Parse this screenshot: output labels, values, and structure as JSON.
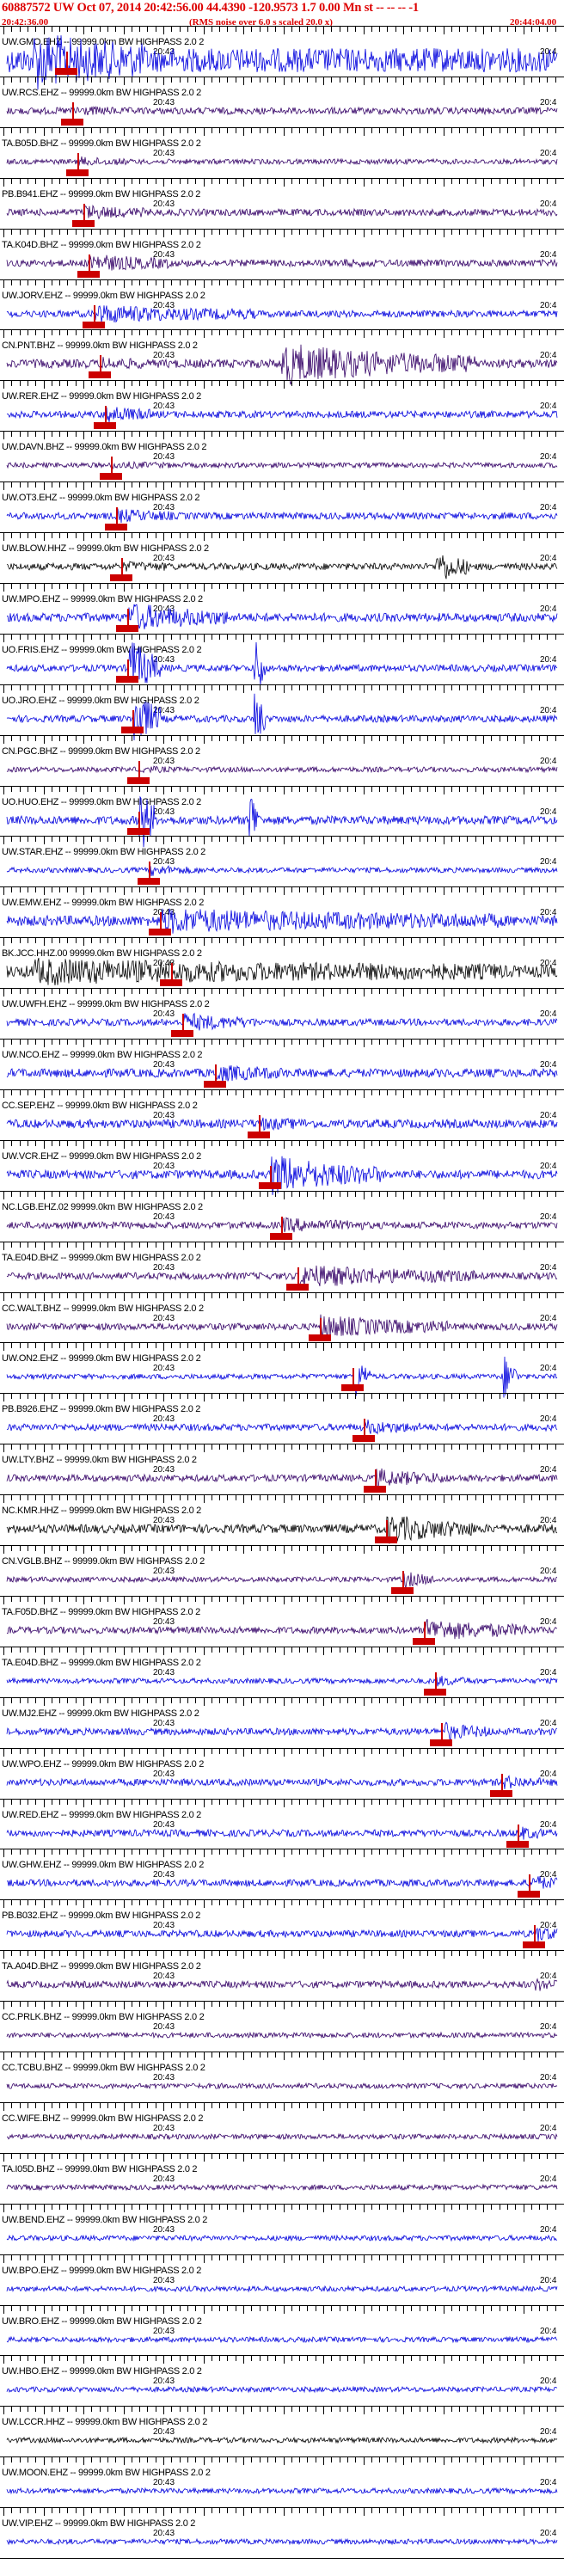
{
  "header": {
    "title": "60887572 UW Oct 07, 2014 20:42:56.00   44.4390 -120.9573  1.7 0.00 Mn st -- -- -- -1",
    "start_time": "20:42:36.00",
    "subtitle": "(RMS noise over 6.0 s scaled 20.0 x)",
    "end_time": "20:44:04.00"
  },
  "chart_data": {
    "type": "line",
    "title": "60887572 UW Oct 07, 2014 20:42:56.00   44.4390 -120.9573  1.7 0.00 Mn st -- -- -- -1",
    "x_start": "20:42:36.00",
    "x_end": "20:44:04.00",
    "tick_label_left": "20:43",
    "tick_label_right": "20:4",
    "colors": {
      "blue": "#0000dd",
      "purple": "#330066",
      "black": "#000000",
      "pick": "#cc0000"
    },
    "traces": [
      {
        "label": "UW.GMO.EHZ -- 99999.0km BW HIGHPASS 2.0 2",
        "color": "blue",
        "amp": 14,
        "pick": 0.11,
        "bursts": [
          [
            0.05,
            0.25,
            2.2
          ],
          [
            0.3,
            0.5,
            1.0
          ]
        ]
      },
      {
        "label": "UW.RCS.EHZ -- 99999.0km BW HIGHPASS 2.0 2",
        "color": "purple",
        "amp": 4,
        "pick": 0.12,
        "bursts": [
          [
            0.12,
            0.2,
            1.5
          ]
        ]
      },
      {
        "label": "TA.B05D.BHZ -- 99999.0km BW HIGHPASS 2.0 2",
        "color": "purple",
        "amp": 3,
        "pick": 0.13,
        "bursts": [
          [
            0.13,
            0.22,
            1.8
          ]
        ]
      },
      {
        "label": "PB.B941.EHZ -- 99999.0km BW HIGHPASS 2.0 2",
        "color": "purple",
        "amp": 4,
        "pick": 0.14,
        "bursts": [
          [
            0.14,
            0.25,
            2.0
          ]
        ]
      },
      {
        "label": "TA.K04D.BHZ -- 99999.0km BW HIGHPASS 2.0 2",
        "color": "purple",
        "amp": 4,
        "pick": 0.15,
        "bursts": [
          [
            0.15,
            0.3,
            2.5
          ],
          [
            0.6,
            0.7,
            1.2
          ]
        ]
      },
      {
        "label": "UW.JORV.EHZ -- 99999.0km BW HIGHPASS 2.0 2",
        "color": "blue",
        "amp": 4,
        "pick": 0.16,
        "bursts": [
          [
            0.16,
            0.45,
            2.5
          ]
        ]
      },
      {
        "label": "CN.PNT.BHZ -- 99999.0km BW HIGHPASS 2.0 2",
        "color": "purple",
        "amp": 5,
        "pick": 0.17,
        "bursts": [
          [
            0.17,
            0.25,
            1.5
          ],
          [
            0.5,
            0.85,
            4.0
          ]
        ]
      },
      {
        "label": "UW.RER.EHZ -- 99999.0km BW HIGHPASS 2.0 2",
        "color": "blue",
        "amp": 4,
        "pick": 0.18,
        "bursts": [
          [
            0.18,
            0.26,
            2.5
          ]
        ]
      },
      {
        "label": "UW.DAVN.BHZ -- 99999.0km BW HIGHPASS 2.0 2",
        "color": "purple",
        "amp": 3,
        "pick": 0.19,
        "bursts": [
          [
            0.19,
            0.3,
            1.5
          ]
        ]
      },
      {
        "label": "UW.OT3.EHZ -- 99999.0km BW HIGHPASS 2.0 2",
        "color": "blue",
        "amp": 4,
        "pick": 0.2,
        "bursts": [
          [
            0.2,
            0.3,
            2.0
          ]
        ]
      },
      {
        "label": "UW.BLOW.HHZ -- 99999.0km BW HIGHPASS 2.0 2",
        "color": "black",
        "amp": 4,
        "pick": 0.21,
        "bursts": [
          [
            0.21,
            0.3,
            1.5
          ],
          [
            0.78,
            0.84,
            4.5
          ]
        ]
      },
      {
        "label": "UW.MPO.EHZ -- 99999.0km BW HIGHPASS 2.0 2",
        "color": "blue",
        "amp": 5,
        "pick": 0.22,
        "bursts": [
          [
            0.22,
            0.4,
            3.0
          ]
        ]
      },
      {
        "label": "UO.FRIS.EHZ -- 99999.0km BW HIGHPASS 2.0 2",
        "color": "blue",
        "amp": 4,
        "pick": 0.22,
        "bursts": [
          [
            0.22,
            0.28,
            8.0
          ],
          [
            0.45,
            0.47,
            9.0
          ]
        ]
      },
      {
        "label": "UO.JRO.EHZ -- 99999.0km BW HIGHPASS 2.0 2",
        "color": "blue",
        "amp": 4,
        "pick": 0.23,
        "bursts": [
          [
            0.23,
            0.28,
            8.0
          ],
          [
            0.45,
            0.47,
            9.0
          ]
        ]
      },
      {
        "label": "CN.PGC.BHZ -- 99999.0km BW HIGHPASS 2.0 2",
        "color": "purple",
        "amp": 3,
        "pick": 0.24,
        "bursts": [
          [
            0.24,
            0.3,
            1.5
          ]
        ]
      },
      {
        "label": "UO.HUO.EHZ -- 99999.0km BW HIGHPASS 2.0 2",
        "color": "blue",
        "amp": 5,
        "pick": 0.24,
        "bursts": [
          [
            0.24,
            0.27,
            8.0
          ],
          [
            0.44,
            0.46,
            8.0
          ]
        ]
      },
      {
        "label": "UW.STAR.EHZ -- 99999.0km BW HIGHPASS 2.0 2",
        "color": "blue",
        "amp": 3,
        "pick": 0.26,
        "bursts": [
          [
            0.26,
            0.35,
            2.0
          ]
        ]
      },
      {
        "label": "UW.EMW.EHZ -- 99999.0km BW HIGHPASS 2.0 2",
        "color": "blue",
        "amp": 6,
        "pick": 0.28,
        "bursts": [
          [
            0.28,
            0.9,
            2.2
          ]
        ]
      },
      {
        "label": "BK.JCC.HHZ.00 99999.0km BW HIGHPASS 2.0 2",
        "color": "black",
        "amp": 7,
        "pick": 0.3,
        "bursts": [
          [
            0.05,
            0.9,
            2.0
          ]
        ]
      },
      {
        "label": "UW.UWFH.EHZ -- 99999.0km BW HIGHPASS 2.0 2",
        "color": "blue",
        "amp": 4,
        "pick": 0.32,
        "bursts": [
          [
            0.32,
            0.45,
            2.5
          ]
        ]
      },
      {
        "label": "UW.NCO.EHZ -- 99999.0km BW HIGHPASS 2.0 2",
        "color": "blue",
        "amp": 5,
        "pick": 0.38,
        "bursts": [
          [
            0.38,
            0.5,
            2.0
          ]
        ]
      },
      {
        "label": "CC.SEP.EHZ -- 99999.0km BW HIGHPASS 2.0 2",
        "color": "blue",
        "amp": 5,
        "pick": 0.46,
        "bursts": [
          [
            0.46,
            0.55,
            1.5
          ]
        ]
      },
      {
        "label": "UW.VCR.EHZ -- 99999.0km BW HIGHPASS 2.0 2",
        "color": "blue",
        "amp": 5,
        "pick": 0.48,
        "bursts": [
          [
            0.48,
            0.68,
            4.0
          ]
        ]
      },
      {
        "label": "NC.LGB.EHZ.02 99999.0km BW HIGHPASS 2.0 2",
        "color": "purple",
        "amp": 4,
        "pick": 0.5,
        "bursts": [
          [
            0.5,
            0.65,
            2.0
          ]
        ]
      },
      {
        "label": "TA.E04D.BHZ -- 99999.0km BW HIGHPASS 2.0 2",
        "color": "purple",
        "amp": 4,
        "pick": 0.53,
        "bursts": [
          [
            0.53,
            0.85,
            3.0
          ]
        ]
      },
      {
        "label": "CC.WALT.BHZ -- 99999.0km BW HIGHPASS 2.0 2",
        "color": "purple",
        "amp": 4,
        "pick": 0.57,
        "bursts": [
          [
            0.57,
            0.8,
            3.0
          ]
        ]
      },
      {
        "label": "UW.ON2.EHZ -- 99999.0km BW HIGHPASS 2.0 2",
        "color": "blue",
        "amp": 3,
        "pick": 0.63,
        "bursts": [
          [
            0.63,
            0.66,
            8.0
          ],
          [
            0.9,
            0.93,
            8.0
          ]
        ]
      },
      {
        "label": "PB.B926.EHZ -- 99999.0km BW HIGHPASS 2.0 2",
        "color": "blue",
        "amp": 4,
        "pick": 0.65,
        "bursts": [
          [
            0.65,
            0.75,
            2.0
          ]
        ]
      },
      {
        "label": "UW.LTY.BHZ -- 99999.0km BW HIGHPASS 2.0 2",
        "color": "purple",
        "amp": 4,
        "pick": 0.67,
        "bursts": [
          [
            0.67,
            0.8,
            2.5
          ]
        ]
      },
      {
        "label": "NC.KMR.HHZ -- 99999.0km BW HIGHPASS 2.0 2",
        "color": "black",
        "amp": 5,
        "pick": 0.69,
        "bursts": [
          [
            0.69,
            0.85,
            3.0
          ]
        ]
      },
      {
        "label": "CN.VGLB.BHZ -- 99999.0km BW HIGHPASS 2.0 2",
        "color": "purple",
        "amp": 3,
        "pick": 0.72,
        "bursts": [
          [
            0.72,
            0.78,
            3.0
          ]
        ]
      },
      {
        "label": "TA.F05D.BHZ -- 99999.0km BW HIGHPASS 2.0 2",
        "color": "purple",
        "amp": 4,
        "pick": 0.76,
        "bursts": [
          [
            0.76,
            0.95,
            3.0
          ]
        ]
      },
      {
        "label": "TA.E04D.BHZ -- 99999.0km BW HIGHPASS 2.0 2",
        "color": "blue",
        "amp": 3,
        "pick": 0.78,
        "bursts": [
          [
            0.78,
            0.85,
            2.0
          ]
        ]
      },
      {
        "label": "UW.MJ2.EHZ -- 99999.0km BW HIGHPASS 2.0 2",
        "color": "blue",
        "amp": 4,
        "pick": 0.79,
        "bursts": [
          [
            0.79,
            0.88,
            2.5
          ]
        ]
      },
      {
        "label": "UW.WPO.EHZ -- 99999.0km BW HIGHPASS 2.0 2",
        "color": "blue",
        "amp": 4,
        "pick": 0.9,
        "bursts": [
          [
            0.9,
            0.97,
            2.0
          ]
        ]
      },
      {
        "label": "UW.RED.EHZ -- 99999.0km BW HIGHPASS 2.0 2",
        "color": "blue",
        "amp": 4,
        "pick": 0.93,
        "bursts": [
          [
            0.93,
            0.98,
            2.0
          ]
        ]
      },
      {
        "label": "UW.GHW.EHZ -- 99999.0km BW HIGHPASS 2.0 2",
        "color": "blue",
        "amp": 4,
        "pick": 0.95,
        "bursts": [
          [
            0.95,
            1.0,
            2.5
          ]
        ]
      },
      {
        "label": "PB.B032.EHZ -- 99999.0km BW HIGHPASS 2.0 2",
        "color": "blue",
        "amp": 4,
        "pick": 0.96,
        "bursts": [
          [
            0.96,
            1.0,
            2.5
          ]
        ]
      },
      {
        "label": "TA.A04D.BHZ -- 99999.0km BW HIGHPASS 2.0 2",
        "color": "purple",
        "amp": 4,
        "pick": null,
        "bursts": [
          [
            0.96,
            1.0,
            2.0
          ]
        ]
      },
      {
        "label": "CC.PRLK.BHZ -- 99999.0km BW HIGHPASS 2.0 2",
        "color": "purple",
        "amp": 3,
        "pick": null,
        "bursts": []
      },
      {
        "label": "CC.TCBU.BHZ -- 99999.0km BW HIGHPASS 2.0 2",
        "color": "purple",
        "amp": 3,
        "pick": null,
        "bursts": []
      },
      {
        "label": "CC.WIFE.BHZ -- 99999.0km BW HIGHPASS 2.0 2",
        "color": "purple",
        "amp": 3,
        "pick": null,
        "bursts": []
      },
      {
        "label": "TA.I05D.BHZ -- 99999.0km BW HIGHPASS 2.0 2",
        "color": "purple",
        "amp": 3,
        "pick": null,
        "bursts": []
      },
      {
        "label": "UW.BEND.EHZ -- 99999.0km BW HIGHPASS 2.0 2",
        "color": "blue",
        "amp": 3,
        "pick": null,
        "bursts": []
      },
      {
        "label": "UW.BPO.EHZ -- 99999.0km BW HIGHPASS 2.0 2",
        "color": "blue",
        "amp": 3,
        "pick": null,
        "bursts": []
      },
      {
        "label": "UW.BRO.EHZ -- 99999.0km BW HIGHPASS 2.0 2",
        "color": "blue",
        "amp": 3,
        "pick": null,
        "bursts": []
      },
      {
        "label": "UW.HBO.EHZ -- 99999.0km BW HIGHPASS 2.0 2",
        "color": "blue",
        "amp": 3,
        "pick": null,
        "bursts": []
      },
      {
        "label": "UW.LCCR.HHZ -- 99999.0km BW HIGHPASS 2.0 2",
        "color": "black",
        "amp": 3,
        "pick": null,
        "bursts": []
      },
      {
        "label": "UW.MOON.EHZ -- 99999.0km BW HIGHPASS 2.0 2",
        "color": "blue",
        "amp": 3,
        "pick": null,
        "bursts": []
      },
      {
        "label": "UW.VIP.EHZ -- 99999.0km BW HIGHPASS 2.0 2",
        "color": "blue",
        "amp": 3,
        "pick": null,
        "bursts": []
      }
    ]
  }
}
